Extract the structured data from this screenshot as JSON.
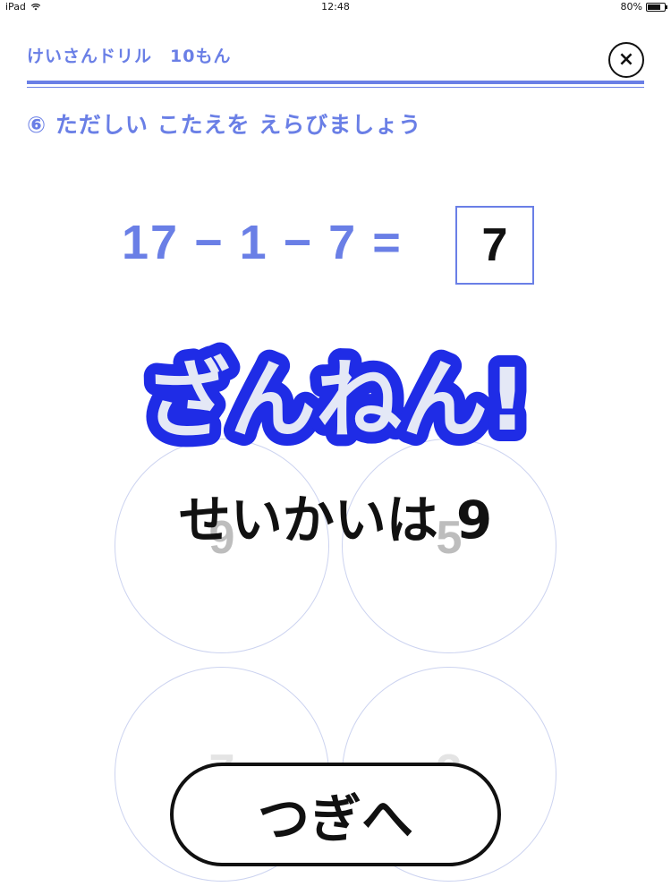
{
  "status_bar": {
    "device": "iPad",
    "time": "12:48",
    "battery_label": "80%",
    "battery_level": 0.8,
    "wifi_icon": "wifi-icon",
    "battery_icon": "battery-icon"
  },
  "header": {
    "title": "けいさんドリル　10もん",
    "close_label": "×",
    "close_icon": "close-icon"
  },
  "question": {
    "prompt": "⑥ ただしい こたえを えらびましょう",
    "equation": "17 − 1 − 7 =",
    "selected_answer": "7"
  },
  "choices": [
    "9",
    "5",
    "7",
    "3"
  ],
  "result": {
    "banner": "ざんねん!",
    "correct_text": "せいかいは 9"
  },
  "next_button_label": "つぎへ",
  "colors": {
    "accent": "#6a7fe6",
    "banner_stroke": "#1f2ce6",
    "banner_fill": "#e4e8f6",
    "text": "#111111"
  }
}
